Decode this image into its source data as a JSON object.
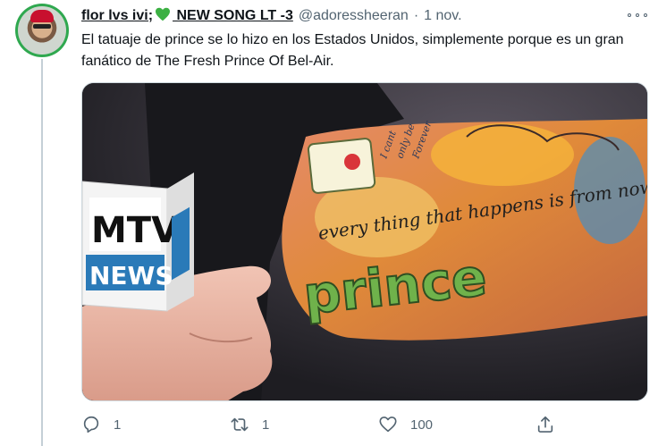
{
  "tweet": {
    "display_name": "flor lvs ivi;",
    "display_name_suffix": " NEW SONG LT -3",
    "handle": "@adoressheeran",
    "separator": "·",
    "date": "1 nov.",
    "text": "El tatuaje de prince se lo hizo en los Estados Unidos, simplemente porque es un gran fanático de The Fresh Prince Of Bel-Air.",
    "heart_color": "#3cb043"
  },
  "media": {
    "mic_flag_brand": "MTV",
    "mic_flag_sub": "NEWS",
    "tattoo_line": "every thing that happens is from now on",
    "tattoo_word": "prince",
    "tattoo_small_1": "I cant",
    "tattoo_small_2": "only be",
    "tattoo_small_3": "Forever"
  },
  "actions": {
    "reply_count": "1",
    "retweet_count": "1",
    "like_count": "100"
  },
  "colors": {
    "text_secondary": "#536471",
    "avatar_ring": "#2fa84f",
    "mtv_blue": "#2a7ab8"
  }
}
